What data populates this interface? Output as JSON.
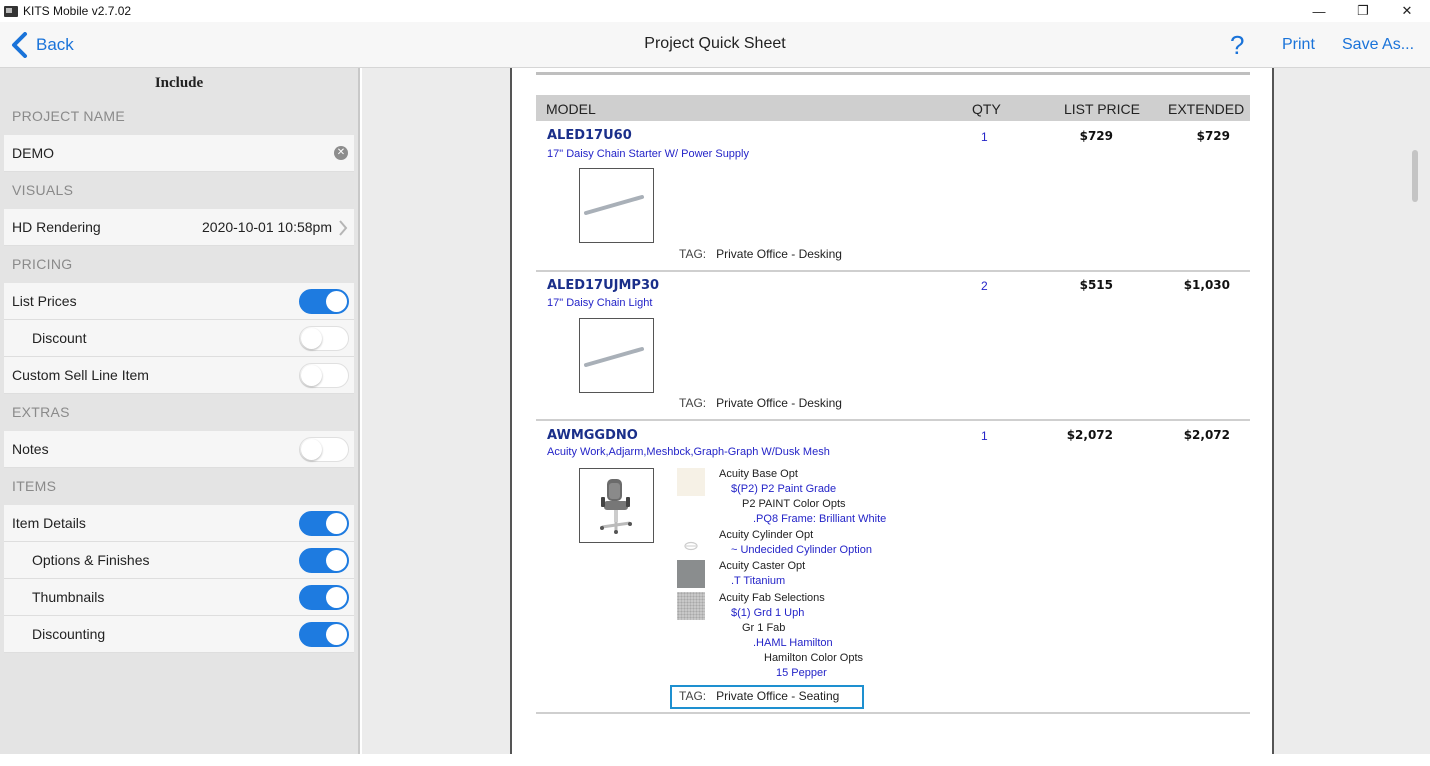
{
  "window": {
    "title": "KITS Mobile v2.7.02",
    "minimize_symbol": "—",
    "restore_symbol": "❐",
    "close_symbol": "✕"
  },
  "nav": {
    "back_label": "Back",
    "title": "Project Quick Sheet",
    "help_symbol": "?",
    "print_label": "Print",
    "save_as_label": "Save As..."
  },
  "sidebar": {
    "header": "Include",
    "project_name_section": "PROJECT NAME",
    "project_name_value": "DEMO",
    "visuals_section": "VISUALS",
    "hd_rendering_label": "HD Rendering",
    "hd_rendering_value": "2020-10-01 10:58pm",
    "pricing_section": "PRICING",
    "list_prices_label": "List Prices",
    "discount_label": "Discount",
    "custom_sell_label": "Custom Sell Line Item",
    "extras_section": "EXTRAS",
    "notes_label": "Notes",
    "items_section": "ITEMS",
    "item_details_label": "Item Details",
    "options_finishes_label": "Options & Finishes",
    "thumbnails_label": "Thumbnails",
    "discounting_label": "Discounting",
    "toggles": {
      "list_prices": true,
      "discount": false,
      "custom_sell": false,
      "notes": false,
      "item_details": true,
      "options_finishes": true,
      "thumbnails": true,
      "discounting": true
    }
  },
  "sheet": {
    "col_model": "MODEL",
    "col_qty": "QTY",
    "col_list_price": "LIST PRICE",
    "col_extended": "EXTENDED",
    "tag_key": "TAG:",
    "items": [
      {
        "model": "ALED17U60",
        "description": "17\" Daisy Chain Starter W/ Power Supply",
        "qty": "1",
        "list_price": "$729",
        "extended": "$729",
        "tag": "Private Office - Desking"
      },
      {
        "model": "ALED17UJMP30",
        "description": "17\" Daisy Chain Light",
        "qty": "2",
        "list_price": "$515",
        "extended": "$1,030",
        "tag": "Private Office - Desking"
      },
      {
        "model": "AWMGGDNO",
        "description": "Acuity Work,Adjarm,Meshbck,Graph-Graph W/Dusk Mesh",
        "qty": "1",
        "list_price": "$2,072",
        "extended": "$2,072",
        "tag": "Private Office - Seating",
        "options": [
          "Acuity Base Opt",
          "$(P2)   P2 Paint Grade",
          "P2 PAINT Color Opts",
          ".PQ8   Frame: Brilliant White",
          "Acuity Cylinder Opt",
          "~   Undecided Cylinder Option",
          "Acuity Caster Opt",
          ".T   Titanium",
          "Acuity Fab Selections",
          "$(1)   Grd 1 Uph",
          "Gr 1 Fab",
          ".HAML   Hamilton",
          "Hamilton Color Opts",
          "15   Pepper"
        ]
      }
    ]
  },
  "colors": {
    "accent": "#1a73d9",
    "toggle_on": "#1e7be0",
    "model_text": "#1a2f8a",
    "option_text": "#2424c8",
    "highlight_box": "#1e90d0"
  }
}
